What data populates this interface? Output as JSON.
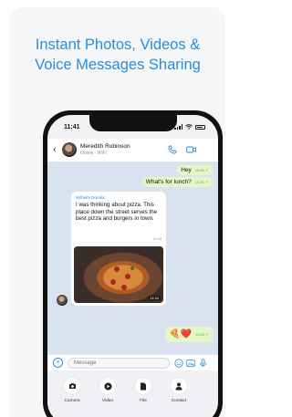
{
  "headline": {
    "line1": "Instant Photos, Videos &",
    "line2": "Voice Messages Sharing"
  },
  "status_bar": {
    "time": "11:41"
  },
  "chat_header": {
    "contact_name": "Meredith Robinson",
    "contact_status": "Online · WiFi"
  },
  "messages": {
    "outgoing": [
      {
        "text": "Hey",
        "time": "10:30"
      },
      {
        "text": "What's for lunch?",
        "time": "10:31"
      }
    ],
    "incoming": {
      "sender": "Wilhelm Donald",
      "text": "I was thinking about pizza. This place down the street serves the best pizza and burgers in town.",
      "time": "11:33",
      "photo_time": "11:34"
    },
    "emoji_reply": {
      "text": "🍕❤️",
      "time": "11:35"
    }
  },
  "input_bar": {
    "placeholder": "Message"
  },
  "attachments": [
    {
      "label": "Camera",
      "icon": "camera-icon"
    },
    {
      "label": "Video",
      "icon": "play-icon"
    },
    {
      "label": "File",
      "icon": "file-icon"
    },
    {
      "label": "Contact",
      "icon": "person-icon"
    }
  ],
  "colors": {
    "accent": "#2a8fd8",
    "outgoing_bubble": "#e3f7c8",
    "chat_background": "#d8e3ef"
  }
}
